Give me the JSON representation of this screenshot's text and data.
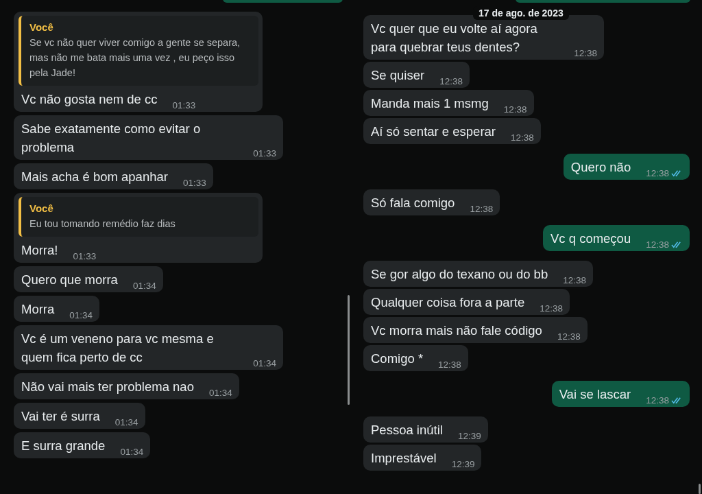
{
  "panels": [
    {
      "messages": [
        {
          "kind": "incoming",
          "quote": {
            "author": "Você",
            "text": "Se vc não quer viver comigo a gente se separa, mas não me bata mais uma vez , eu peço isso pela Jade!"
          },
          "text": "Vc não gosta nem de cc",
          "time": "01:33"
        },
        {
          "kind": "incoming",
          "text": "Sabe exatamente como evitar o problema",
          "time": "01:33"
        },
        {
          "kind": "incoming",
          "text": "Mais acha é bom apanhar",
          "time": "01:33"
        },
        {
          "kind": "incoming",
          "quote": {
            "author": "Você",
            "text": "Eu tou tomando remédio faz dias"
          },
          "text": "Morra!",
          "time": "01:33"
        },
        {
          "kind": "incoming",
          "text": "Quero que morra",
          "time": "01:34"
        },
        {
          "kind": "incoming",
          "text": "Morra",
          "time": "01:34"
        },
        {
          "kind": "incoming",
          "text": "Vc é um veneno para vc mesma e quem fica perto de cc",
          "time": "01:34"
        },
        {
          "kind": "incoming",
          "text": "Não vai mais ter problema nao",
          "time": "01:34"
        },
        {
          "kind": "incoming",
          "text": "Vai ter é surra",
          "time": "01:34"
        },
        {
          "kind": "incoming",
          "text": "E surra grande",
          "time": "01:34"
        }
      ]
    },
    {
      "date": "17 de ago. de 2023",
      "messages": [
        {
          "kind": "incoming",
          "text": "Vc quer que eu volte aí agora para quebrar teus dentes?",
          "time": "12:38"
        },
        {
          "kind": "incoming",
          "text": "Se quiser",
          "time": "12:38"
        },
        {
          "kind": "incoming",
          "text": "Manda mais 1 msmg",
          "time": "12:38"
        },
        {
          "kind": "incoming",
          "text": "Aí só sentar e esperar",
          "time": "12:38"
        },
        {
          "kind": "outgoing",
          "text": "Quero não",
          "time": "12:38",
          "read": true
        },
        {
          "kind": "incoming",
          "text": "Só fala comigo",
          "time": "12:38"
        },
        {
          "kind": "outgoing",
          "text": "Vc q começou",
          "time": "12:38",
          "read": true
        },
        {
          "kind": "incoming",
          "text": "Se gor algo do texano ou do bb",
          "time": "12:38"
        },
        {
          "kind": "incoming",
          "text": "Qualquer coisa fora a parte",
          "time": "12:38"
        },
        {
          "kind": "incoming",
          "text": "Vc morra mais não fale código",
          "time": "12:38"
        },
        {
          "kind": "incoming",
          "text": "Comigo *",
          "time": "12:38"
        },
        {
          "kind": "outgoing",
          "text": "Vai se lascar",
          "time": "12:38",
          "read": true
        },
        {
          "kind": "incoming",
          "text": "Pessoa inútil",
          "time": "12:39"
        },
        {
          "kind": "incoming",
          "text": "Imprestável",
          "time": "12:39"
        }
      ]
    }
  ]
}
